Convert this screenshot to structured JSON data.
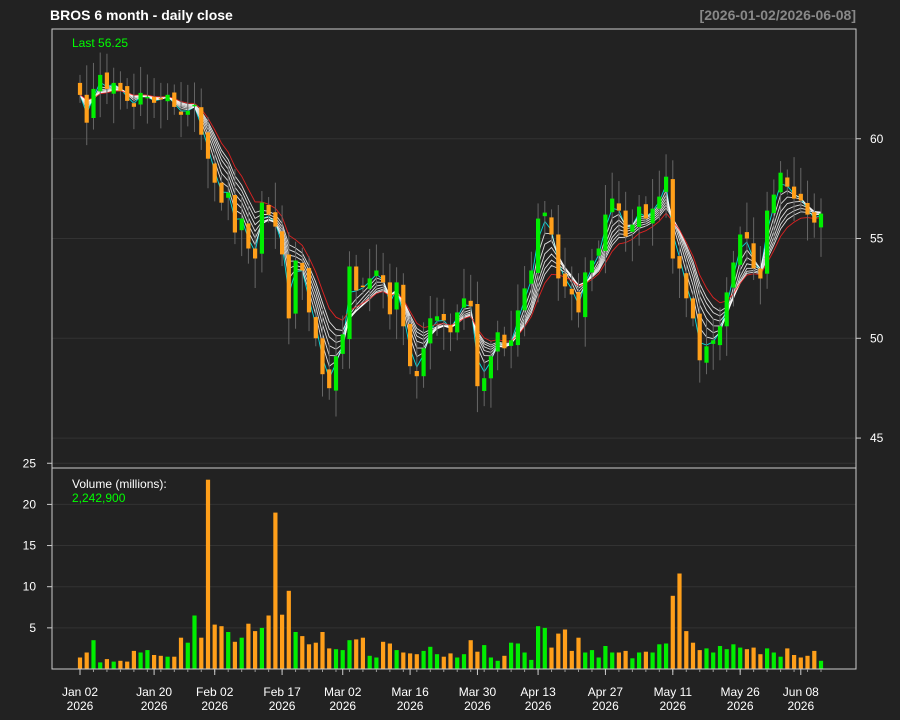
{
  "chart": {
    "title": "BROS  6 month - daily close",
    "date_range": "[2026-01-02/2026-06-08]",
    "last_label": "Last 56.25",
    "volume_label": "Volume (millions):",
    "volume_value": "2,242,900",
    "colors": {
      "background": "#222222",
      "up": "#00ee00",
      "down": "#ff9f1a",
      "grid": "#333333",
      "axis": "#cccccc",
      "text": "#ffffff",
      "last": "#00ff00",
      "range_text": "#888888",
      "ma_long": "#ff2222",
      "ma_short": "#00ffff",
      "ma_mid": "#ffffff"
    }
  },
  "chart_data": [
    {
      "type": "candlestick",
      "title": "BROS  6 month - daily close",
      "ylim": [
        43.5,
        65.5
      ],
      "y_ticks": [
        45,
        50,
        55,
        60
      ],
      "x_ticks": [
        {
          "label": "Jan 02",
          "year": "2026",
          "index": 0
        },
        {
          "label": "Jan 20",
          "year": "2026",
          "index": 11
        },
        {
          "label": "Feb 02",
          "year": "2026",
          "index": 20
        },
        {
          "label": "Feb 17",
          "year": "2026",
          "index": 30
        },
        {
          "label": "Mar 02",
          "year": "2026",
          "index": 39
        },
        {
          "label": "Mar 16",
          "year": "2026",
          "index": 49
        },
        {
          "label": "Mar 30",
          "year": "2026",
          "index": 59
        },
        {
          "label": "Apr 13",
          "year": "2026",
          "index": 68
        },
        {
          "label": "Apr 27",
          "year": "2026",
          "index": 78
        },
        {
          "label": "May 11",
          "year": "2026",
          "index": 88
        },
        {
          "label": "May 26",
          "year": "2026",
          "index": 98
        },
        {
          "label": "Jun 08",
          "year": "2026",
          "index": 107
        }
      ],
      "close": [
        62.2,
        60.8,
        62.5,
        63.2,
        62.5,
        62.8,
        62.4,
        61.9,
        61.6,
        62.3,
        62.1,
        61.8,
        62.0,
        62.2,
        61.6,
        61.2,
        61.4,
        61.7,
        60.2,
        59.0,
        57.8,
        56.8,
        57.3,
        55.3,
        56.0,
        54.5,
        54.0,
        56.8,
        56.2,
        55.6,
        54.2,
        51.0,
        53.9,
        53.4,
        51.3,
        50.0,
        48.2,
        47.5,
        49.1,
        50.2,
        53.6,
        52.4,
        52.6,
        53.0,
        53.4,
        52.8,
        51.2,
        52.8,
        50.6,
        48.6,
        48.1,
        49.5,
        51.0,
        51.1,
        50.9,
        50.3,
        51.3,
        52.0,
        51.6,
        47.6,
        48.0,
        49.1,
        50.3,
        49.5,
        49.9,
        51.4,
        52.5,
        53.4,
        56.0,
        56.3,
        55.2,
        53.0,
        52.6,
        52.2,
        51.3,
        53.3,
        53.9,
        54.5,
        56.2,
        57.0,
        56.4,
        55.1,
        55.7,
        56.6,
        56.0,
        56.5,
        57.1,
        58.1,
        54.0,
        53.5,
        52.0,
        51.0,
        48.9,
        49.6,
        49.9,
        50.6,
        52.3,
        53.8,
        55.2,
        55.0,
        53.5,
        53.0,
        56.4,
        57.2,
        58.3,
        57.6,
        57.0,
        56.9,
        56.2,
        55.8,
        56.25
      ],
      "volume": [
        1.4,
        2.0,
        3.5,
        0.8,
        1.2,
        0.9,
        1.0,
        0.9,
        2.2,
        2.0,
        2.3,
        1.7,
        1.6,
        1.5,
        1.5,
        3.8,
        3.2,
        6.5,
        3.8,
        23.0,
        5.4,
        5.2,
        4.5,
        3.3,
        3.8,
        5.5,
        4.6,
        5.0,
        6.5,
        19.0,
        6.6,
        9.5,
        4.5,
        4.0,
        3.0,
        3.2,
        4.5,
        2.5,
        2.4,
        2.3,
        3.5,
        3.6,
        3.8,
        1.6,
        1.4,
        3.3,
        3.1,
        2.3,
        2.0,
        1.9,
        1.8,
        2.2,
        2.7,
        1.8,
        1.5,
        1.9,
        1.4,
        1.8,
        3.5,
        2.1,
        2.9,
        1.4,
        1.0,
        1.6,
        3.2,
        3.1,
        2.0,
        1.1,
        5.2,
        5.0,
        2.6,
        4.3,
        4.8,
        2.2,
        3.8,
        2.0,
        2.3,
        1.4,
        2.8,
        2.0,
        2.0,
        2.2,
        1.3,
        2.0,
        2.1,
        2.0,
        3.0,
        3.1,
        8.9,
        11.6,
        4.6,
        3.2,
        2.3,
        2.5,
        2.0,
        2.8,
        2.4,
        3.0,
        2.6,
        2.4,
        2.6,
        1.8,
        2.5,
        2.0,
        1.5,
        2.5,
        1.7,
        1.4,
        1.6,
        2.2,
        1.0,
        1.0
      ]
    }
  ]
}
